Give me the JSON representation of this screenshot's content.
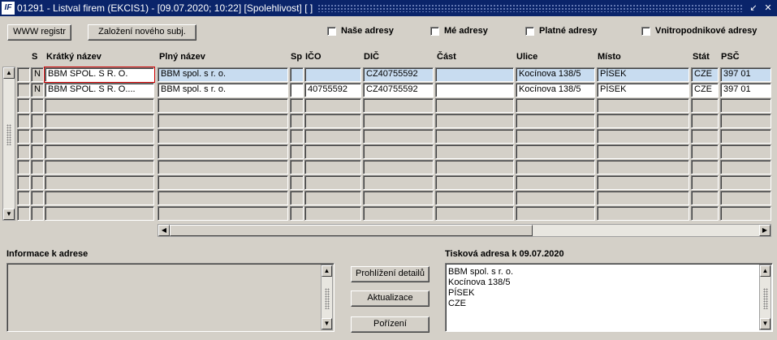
{
  "window": {
    "title": "01291 - Listval firem (EKCIS1) - [09.07.2020; 10:22] [Spolehlivost] [ ]",
    "icon": "app-logo-icon"
  },
  "toolbar": {
    "www_label": "WWW registr",
    "new_subject_label": "Založení nového subj."
  },
  "filters": [
    {
      "label": "Naše adresy",
      "checked": false
    },
    {
      "label": "Mé adresy",
      "checked": false
    },
    {
      "label": "Platné adresy",
      "checked": false
    },
    {
      "label": "Vnitropodnikové adresy",
      "checked": false
    }
  ],
  "grid": {
    "columns": [
      "S",
      "Krátký název",
      "Plný název",
      "Sp",
      "IČO",
      "DIČ",
      "Část",
      "Ulice",
      "Místo",
      "Stát",
      "PSČ"
    ],
    "rows": [
      {
        "s": "N",
        "short": "BBM SPOL. S R. O.",
        "full": "BBM spol. s r. o.",
        "sp": "",
        "ico": "",
        "dic": "CZ40755592",
        "cast": "",
        "ulice": "Kocínova 138/5",
        "misto": "PÍSEK",
        "stat": "CZE",
        "psc": "397 01"
      },
      {
        "s": "N",
        "short": "BBM SPOL. S R. O....",
        "full": "BBM spol. s r. o.",
        "sp": "",
        "ico": "40755592",
        "dic": "CZ40755592",
        "cast": "",
        "ulice": "Kocínova 138/5",
        "misto": "PÍSEK",
        "stat": "CZE",
        "psc": "397 01"
      }
    ],
    "empty_rows": 8
  },
  "info": {
    "label": "Informace k adrese",
    "text": ""
  },
  "actions": {
    "details_label": "Prohlížení detailů",
    "update_label": "Aktualizace",
    "create_label": "Pořízení"
  },
  "print_address": {
    "label": "Tisková adresa k 09.07.2020",
    "lines": [
      "BBM spol. s r. o.",
      "Kocínova 138/5",
      "PÍSEK",
      "CZE"
    ]
  },
  "colors": {
    "titlebar": "#0a246a",
    "window": "#d4d0c8",
    "selected_row": "#c8dcf0",
    "active_border": "#d00000"
  }
}
